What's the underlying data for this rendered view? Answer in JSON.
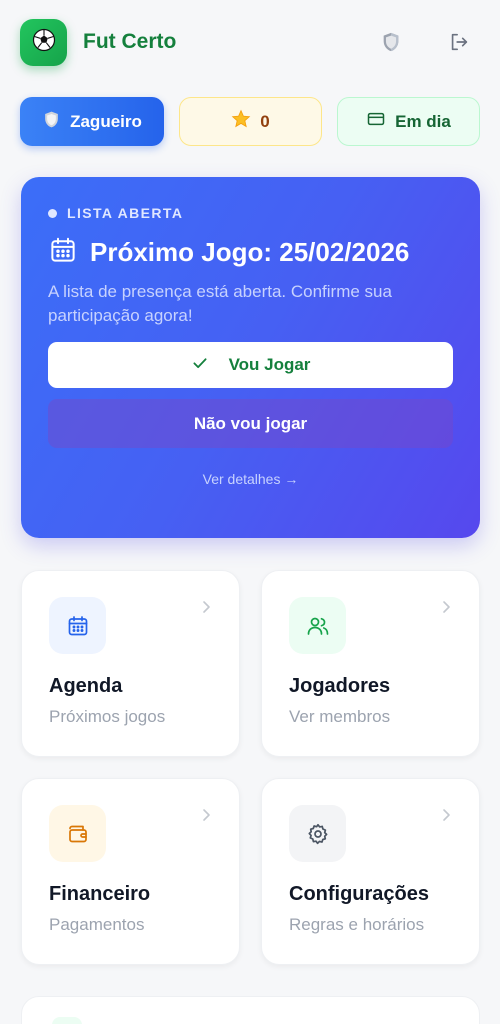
{
  "header": {
    "app_title": "Fut Certo",
    "icons": [
      "soccer-ball-icon",
      "shield-icon",
      "logout-icon"
    ]
  },
  "status": {
    "role_label": "Zagueiro",
    "stars_count": "0",
    "finance_label": "Em dia"
  },
  "next_game": {
    "status_label": "LISTA ABERTA",
    "title": "Próximo Jogo: 25/02/2026",
    "description": "A lista de presença está aberta. Confirme sua participação agora!",
    "confirm_label": "Vou Jogar",
    "decline_label": "Não vou jogar",
    "details_label": "Ver detalhes →"
  },
  "tiles": [
    {
      "title": "Agenda",
      "subtitle": "Próximos jogos",
      "icon": "calendar-icon"
    },
    {
      "title": "Jogadores",
      "subtitle": "Ver membros",
      "icon": "users-icon"
    },
    {
      "title": "Financeiro",
      "subtitle": "Pagamentos",
      "icon": "wallet-icon"
    },
    {
      "title": "Configurações",
      "subtitle": "Regras e horários",
      "icon": "gear-icon"
    }
  ],
  "colors": {
    "brand": "#16a34a",
    "primary": "#2563eb",
    "card_gradient_start": "#3b6ef8",
    "card_gradient_end": "#5648ee"
  }
}
